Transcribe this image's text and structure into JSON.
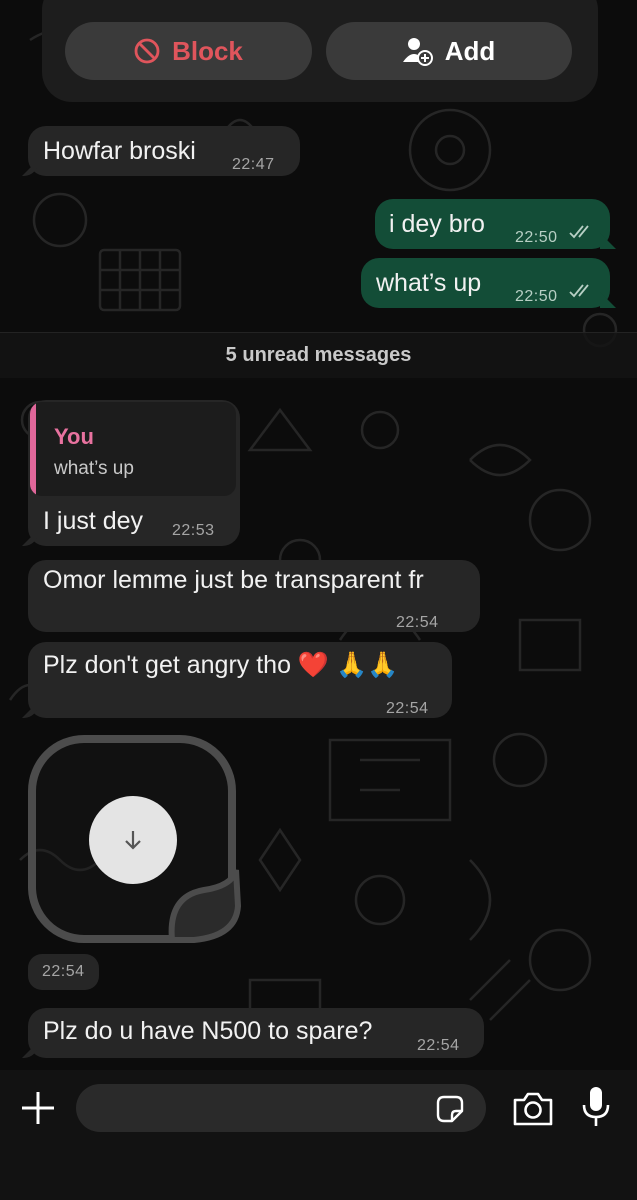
{
  "action_card": {
    "block_label": "Block",
    "add_label": "Add"
  },
  "messages": [
    {
      "text": "Howfar broski",
      "time": "22:47",
      "direction": "in"
    },
    {
      "text": "i dey bro",
      "time": "22:50",
      "direction": "out"
    },
    {
      "text": "what’s up",
      "time": "22:50",
      "direction": "out"
    },
    {
      "text": "I just dey",
      "time": "22:53",
      "direction": "in",
      "quote": {
        "author": "You",
        "text": "what’s up"
      }
    },
    {
      "text": "Omor lemme just be transparent fr",
      "time": "22:54",
      "direction": "in"
    },
    {
      "text": "Plz don't get angry tho ❤️ 🙏🙏",
      "time": "22:54",
      "direction": "in"
    },
    {
      "text": "Plz do u have N500 to spare?",
      "time": "22:54",
      "direction": "in"
    }
  ],
  "unread_divider": "5 unread messages",
  "sticker": {
    "time": "22:54"
  },
  "composer": {
    "value": "",
    "placeholder": ""
  },
  "colors": {
    "incoming_bubble": "#262626",
    "outgoing_bubble": "#134d37",
    "block_red": "#e0555c",
    "quote_pink": "#e8729f"
  },
  "icons": [
    "block-icon",
    "add-contact-icon",
    "double-check-icon",
    "download-arrow-icon",
    "plus-icon",
    "sticker-icon",
    "camera-icon",
    "microphone-icon"
  ]
}
